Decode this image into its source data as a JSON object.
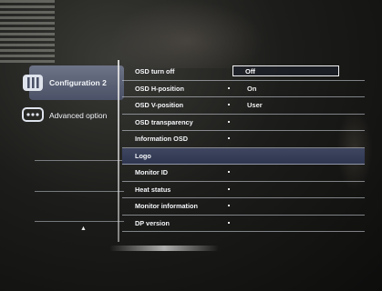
{
  "sidebar": {
    "items": [
      {
        "label": "Configuration 2",
        "icon": "bars-icon",
        "selected": true
      },
      {
        "label": "Advanced option",
        "icon": "chat-dots-icon",
        "selected": false
      }
    ],
    "scroll_arrow": "▲"
  },
  "menu": {
    "items": [
      {
        "label": "OSD turn off"
      },
      {
        "label": "OSD H-position"
      },
      {
        "label": "OSD V-position"
      },
      {
        "label": "OSD transparency"
      },
      {
        "label": "Information OSD"
      },
      {
        "label": "Logo",
        "highlighted": true
      },
      {
        "label": "Monitor ID"
      },
      {
        "label": "Heat status"
      },
      {
        "label": "Monitor information"
      },
      {
        "label": "DP version"
      }
    ],
    "options": {
      "selected": "Off",
      "list": [
        "Off",
        "On",
        "User"
      ]
    }
  },
  "colors": {
    "selected_sidebar": "#5d6377",
    "highlight_row": "#363d57",
    "text": "#f4f6f9"
  }
}
